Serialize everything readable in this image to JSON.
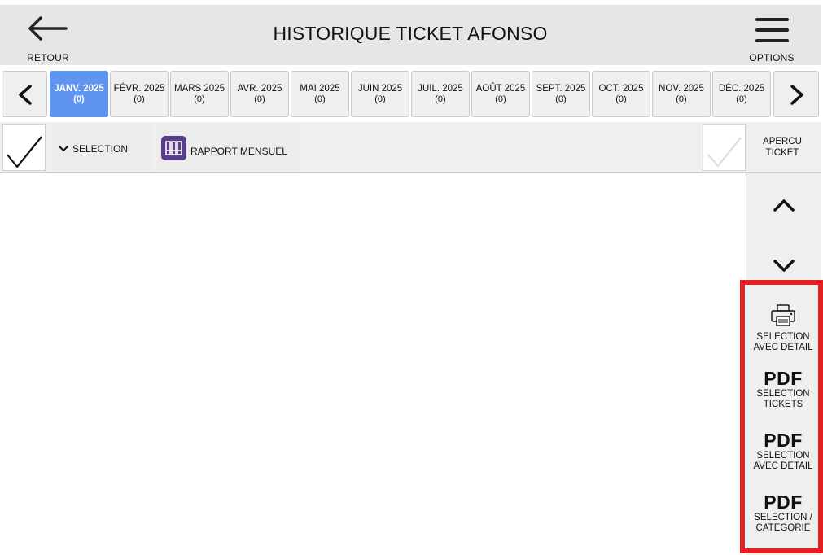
{
  "header": {
    "title": "HISTORIQUE TICKET AFONSO",
    "back_label": "RETOUR",
    "options_label": "OPTIONS"
  },
  "months": [
    {
      "label": "JANV. 2025",
      "count": "(0)",
      "active": true
    },
    {
      "label": "FÉVR. 2025",
      "count": "(0)"
    },
    {
      "label": "MARS 2025",
      "count": "(0)"
    },
    {
      "label": "AVR. 2025",
      "count": "(0)"
    },
    {
      "label": "MAI 2025",
      "count": "(0)"
    },
    {
      "label": "JUIN 2025",
      "count": "(0)"
    },
    {
      "label": "JUIL. 2025",
      "count": "(0)"
    },
    {
      "label": "AOÛT 2025",
      "count": "(0)"
    },
    {
      "label": "SEPT. 2025",
      "count": "(0)"
    },
    {
      "label": "OCT. 2025",
      "count": "(0)"
    },
    {
      "label": "NOV. 2025",
      "count": "(0)"
    },
    {
      "label": "DÉC. 2025",
      "count": "(0)"
    }
  ],
  "toolbar": {
    "selection_label": "SELECTION",
    "rapport_label": "RAPPORT MENSUEL",
    "apercu_line1": "APERCU",
    "apercu_line2": "TICKET"
  },
  "side_actions": {
    "print_line1": "SELECTION",
    "print_line2": "AVEC DETAIL",
    "pdf_text": "PDF",
    "pdf1_line1": "SELECTION",
    "pdf1_line2": "TICKETS",
    "pdf2_line1": "SELECTION",
    "pdf2_line2": "AVEC DETAIL",
    "pdf3_line1": "SELECTION /",
    "pdf3_line2": "CATEGORIE"
  },
  "colors": {
    "active_month": "#5f95f0",
    "highlight_border": "#e41f1f",
    "rapport_icon": "#5a3e8a"
  },
  "icons": {
    "back": "arrow-left-icon",
    "options": "hamburger-menu-icon",
    "prev": "chevron-left-icon",
    "next": "chevron-right-icon",
    "up": "chevron-up-icon",
    "down": "chevron-down-icon",
    "print": "printer-icon",
    "rapport": "binders-icon"
  }
}
